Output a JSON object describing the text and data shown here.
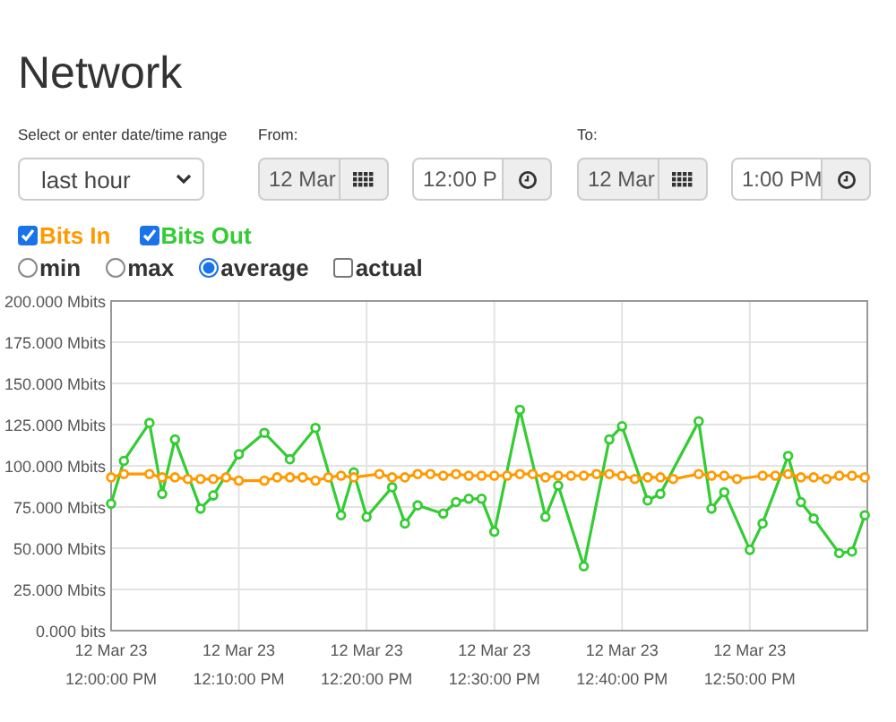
{
  "title": "Network",
  "range": {
    "label": "Select or enter date/time range",
    "value": "last hour"
  },
  "from": {
    "label": "From:",
    "date": "12 Mar",
    "time": "12:00 P"
  },
  "to": {
    "label": "To:",
    "date": "12 Mar",
    "time": "1:00 PM"
  },
  "series_toggles": [
    {
      "checked": true
    },
    {
      "checked": true
    }
  ],
  "modes": [
    {
      "label": "min",
      "kind": "radio",
      "selected": false
    },
    {
      "label": "max",
      "kind": "radio",
      "selected": false
    },
    {
      "label": "average",
      "kind": "radio",
      "selected": true
    },
    {
      "label": "actual",
      "kind": "checkbox",
      "checked": false
    }
  ],
  "chart": {
    "chart_data": {
      "type": "line",
      "categories": [
        "12 Mar 23\n12:00:00 PM",
        null,
        null,
        null,
        null,
        null,
        null,
        null,
        null,
        null,
        "12 Mar 23\n12:10:00 PM",
        null,
        null,
        null,
        null,
        null,
        null,
        null,
        null,
        null,
        "12 Mar 23\n12:20:00 PM",
        null,
        null,
        null,
        null,
        null,
        null,
        null,
        null,
        null,
        "12 Mar 23\n12:30:00 PM",
        null,
        null,
        null,
        null,
        null,
        null,
        null,
        null,
        null,
        "12 Mar 23\n12:40:00 PM",
        null,
        null,
        null,
        null,
        null,
        null,
        null,
        null,
        null,
        "12 Mar 23\n12:50:00 PM",
        null,
        null,
        null,
        null,
        null,
        null,
        null,
        null,
        null
      ],
      "ylim": [
        0,
        200
      ],
      "grid": true,
      "yticks": [
        {
          "value": 0,
          "label": "0.000 bits"
        },
        {
          "value": 25,
          "label": "25.000 Mbits"
        },
        {
          "value": 50,
          "label": "50.000 Mbits"
        },
        {
          "value": 75,
          "label": "75.000 Mbits"
        },
        {
          "value": 100,
          "label": "100.000 Mbits"
        },
        {
          "value": 125,
          "label": "125.000 Mbits"
        },
        {
          "value": 150,
          "label": "150.000 Mbits"
        },
        {
          "value": 175,
          "label": "175.000 Mbits"
        },
        {
          "value": 200,
          "label": "200.000 Mbits"
        }
      ],
      "series": [
        {
          "name": "Bits In",
          "color": "#ff9900",
          "marker": "circle",
          "values": [
            93,
            95,
            null,
            95,
            93,
            93,
            92,
            92,
            92,
            93,
            91,
            null,
            91,
            93,
            93,
            93,
            91,
            93,
            94,
            93,
            null,
            95,
            93,
            93,
            95,
            95,
            94,
            95,
            94,
            94,
            94,
            94,
            95,
            95,
            93,
            94,
            94,
            94,
            95,
            95,
            94,
            92,
            93,
            93,
            92,
            null,
            95,
            94,
            94,
            92,
            null,
            94,
            94,
            95,
            93,
            93,
            92,
            94,
            94,
            93
          ]
        },
        {
          "name": "Bits Out",
          "color": "#33cc33",
          "marker": "circle",
          "values": [
            77,
            103,
            null,
            126,
            83,
            116,
            null,
            74,
            82,
            null,
            107,
            null,
            120,
            null,
            104,
            null,
            123,
            null,
            70,
            96,
            69,
            null,
            87,
            65,
            76,
            null,
            71,
            78,
            80,
            80,
            60,
            null,
            134,
            null,
            69,
            88,
            null,
            39,
            null,
            116,
            124,
            null,
            79,
            83,
            null,
            null,
            127,
            74,
            84,
            null,
            49,
            65,
            null,
            106,
            78,
            68,
            null,
            47,
            48,
            70
          ]
        }
      ]
    }
  }
}
